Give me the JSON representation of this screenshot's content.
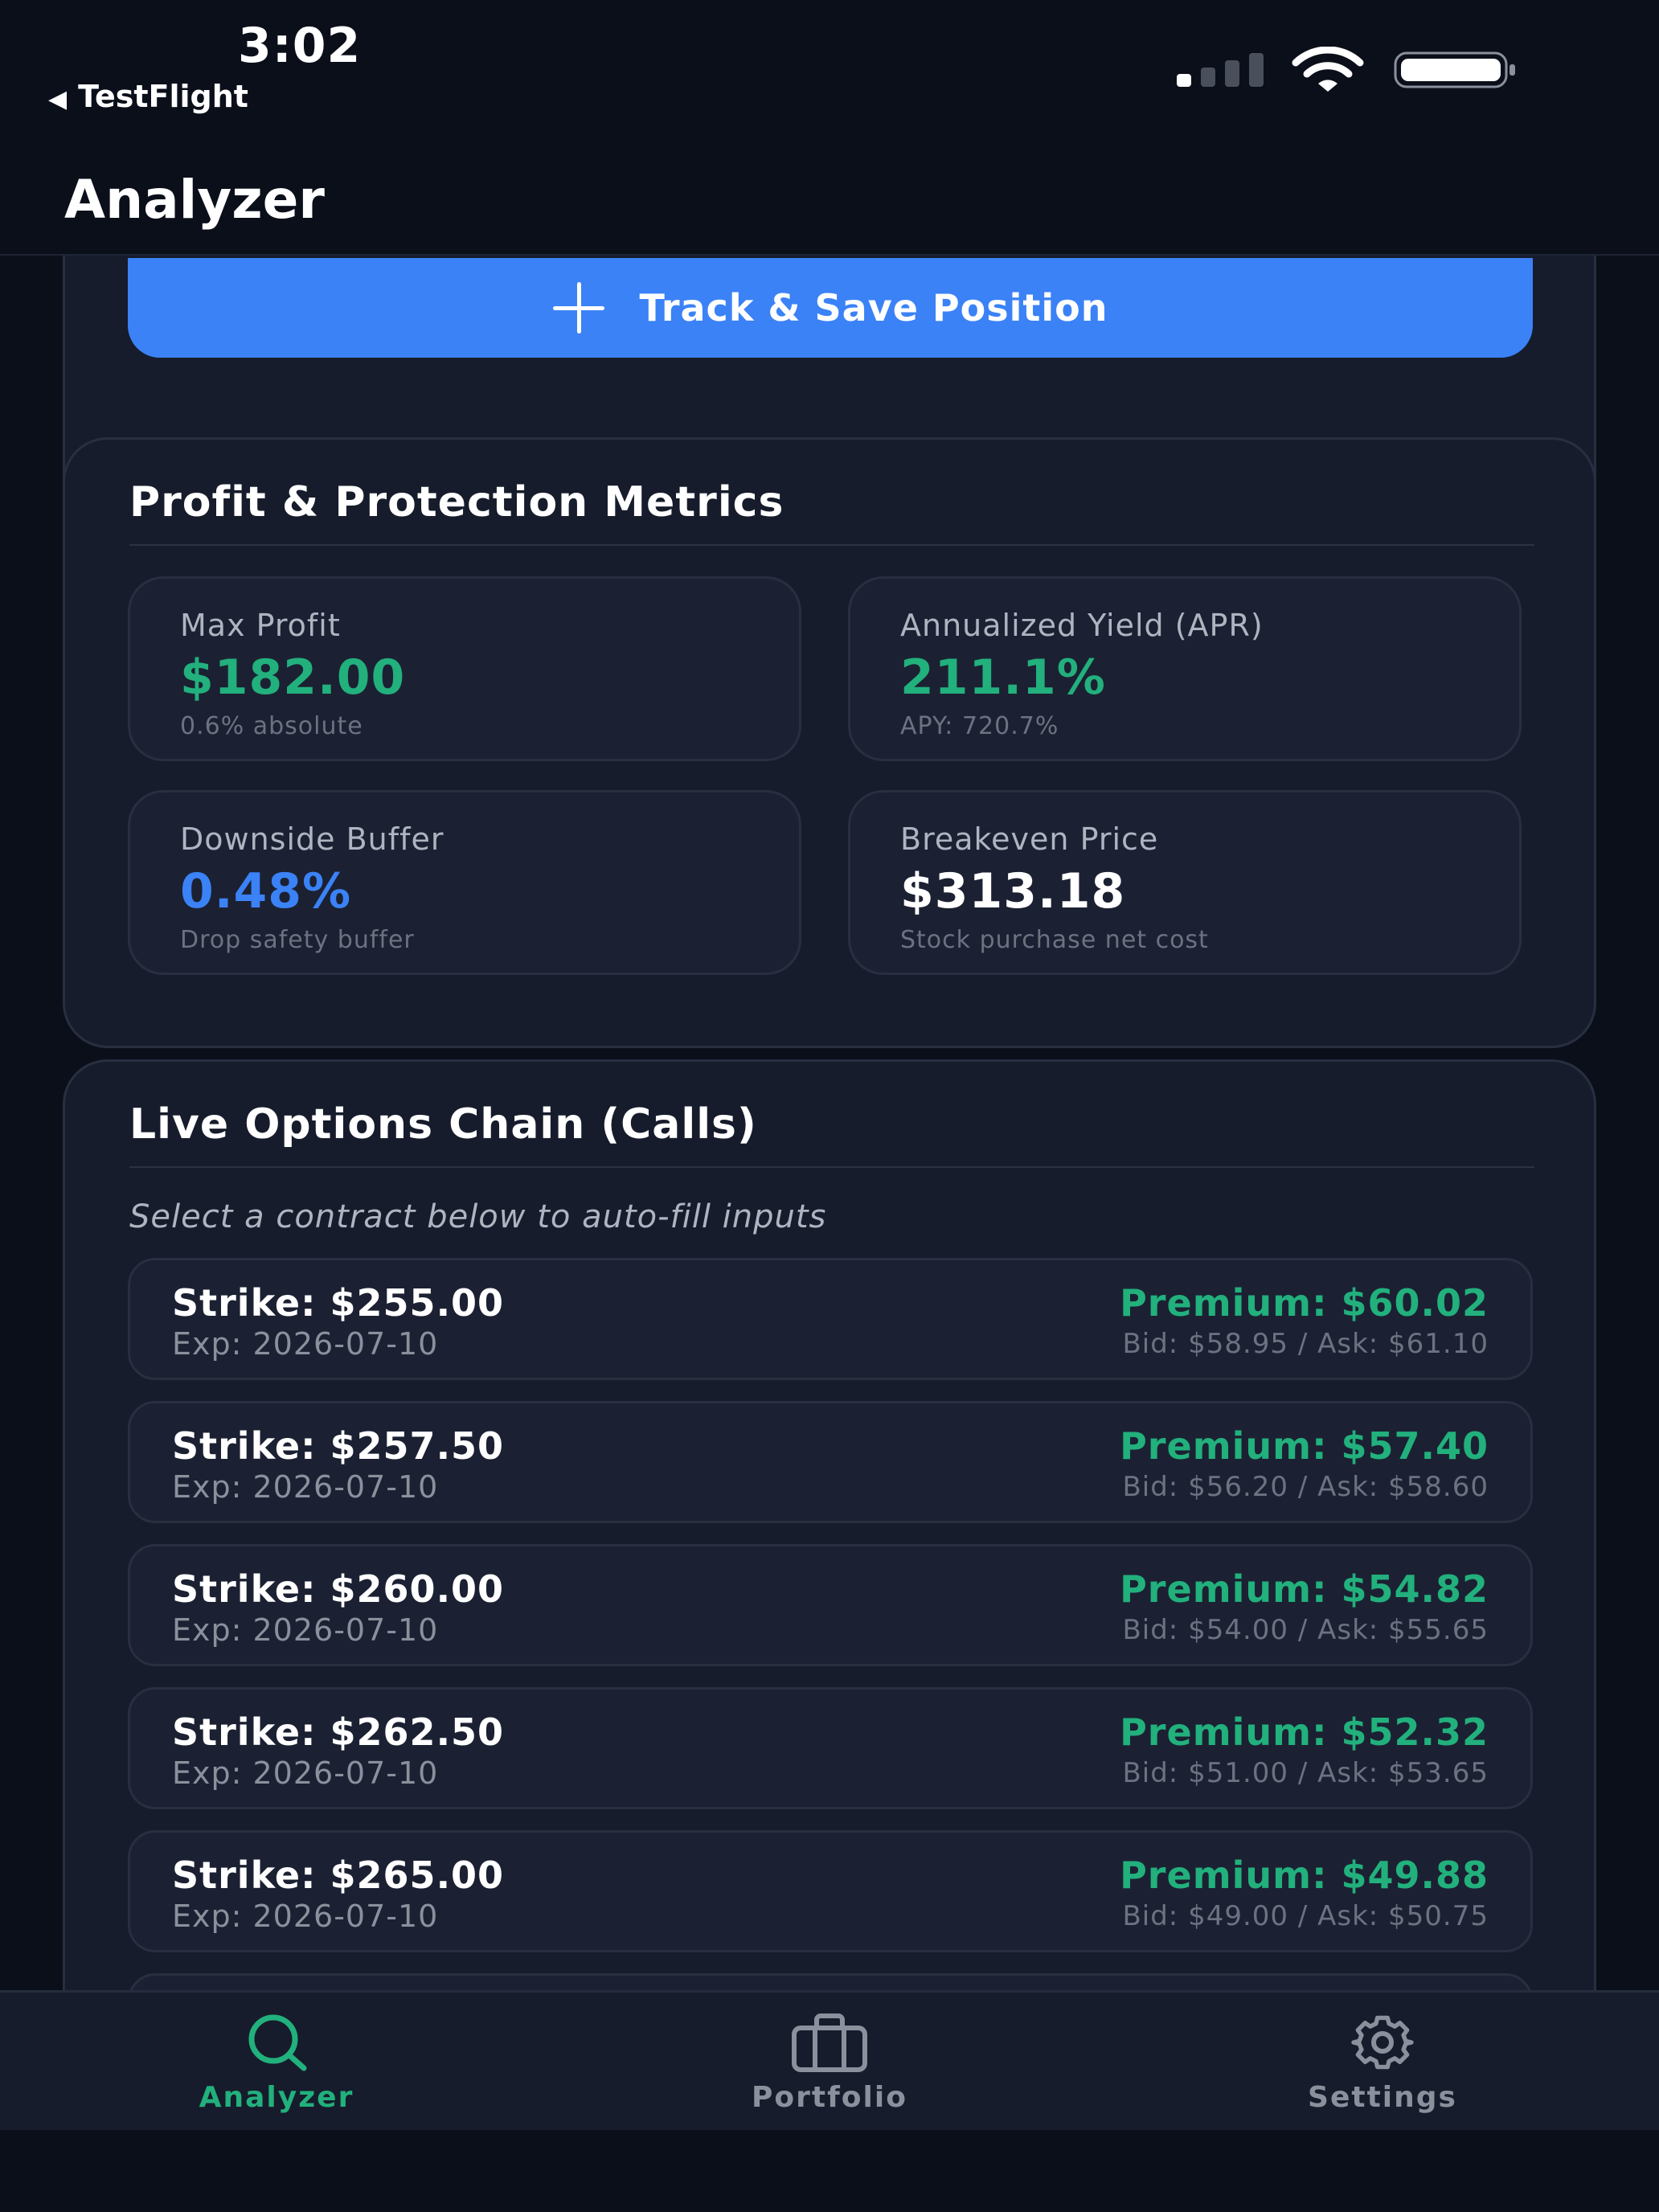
{
  "status_bar": {
    "time": "3:02",
    "back_label": "TestFlight",
    "signal_bars": 4,
    "signal_active": 1,
    "icons": [
      "signal-icon",
      "wifi-icon",
      "battery-icon"
    ]
  },
  "header": {
    "title": "Analyzer"
  },
  "actions": {
    "track_save_label": "Track & Save Position",
    "track_save_icon": "plus-icon"
  },
  "metrics": {
    "title": "Profit & Protection Metrics",
    "items": [
      {
        "label": "Max Profit",
        "value": "$182.00",
        "sub": "0.6% absolute",
        "color": "#22b07d"
      },
      {
        "label": "Annualized Yield (APR)",
        "value": "211.1%",
        "sub": "APY: 720.7%",
        "color": "#22b07d"
      },
      {
        "label": "Downside Buffer",
        "value": "0.48%",
        "sub": "Drop safety buffer",
        "color": "#3b82f6"
      },
      {
        "label": "Breakeven Price",
        "value": "$313.18",
        "sub": "Stock purchase net cost",
        "color": "#ffffff"
      }
    ]
  },
  "options_chain": {
    "title": "Live Options Chain (Calls)",
    "hint": "Select a contract below to auto-fill inputs",
    "rows": [
      {
        "strike": "Strike: $255.00",
        "exp": "Exp: 2026-07-10",
        "premium": "Premium: $60.02",
        "bid_ask": "Bid: $58.95 / Ask: $61.10"
      },
      {
        "strike": "Strike: $257.50",
        "exp": "Exp: 2026-07-10",
        "premium": "Premium: $57.40",
        "bid_ask": "Bid: $56.20 / Ask: $58.60"
      },
      {
        "strike": "Strike: $260.00",
        "exp": "Exp: 2026-07-10",
        "premium": "Premium: $54.82",
        "bid_ask": "Bid: $54.00 / Ask: $55.65"
      },
      {
        "strike": "Strike: $262.50",
        "exp": "Exp: 2026-07-10",
        "premium": "Premium: $52.32",
        "bid_ask": "Bid: $51.00 / Ask: $53.65"
      },
      {
        "strike": "Strike: $265.00",
        "exp": "Exp: 2026-07-10",
        "premium": "Premium: $49.88",
        "bid_ask": "Bid: $49.00 / Ask: $50.75"
      }
    ]
  },
  "tab_bar": {
    "tabs": [
      {
        "label": "Analyzer",
        "icon": "search-icon",
        "active": true
      },
      {
        "label": "Portfolio",
        "icon": "briefcase-icon",
        "active": false
      },
      {
        "label": "Settings",
        "icon": "gear-icon",
        "active": false
      }
    ]
  },
  "colors": {
    "background": "#0b0f1a",
    "card": "#161c2b",
    "accent_blue": "#3b82f6",
    "accent_green": "#22b07d"
  }
}
